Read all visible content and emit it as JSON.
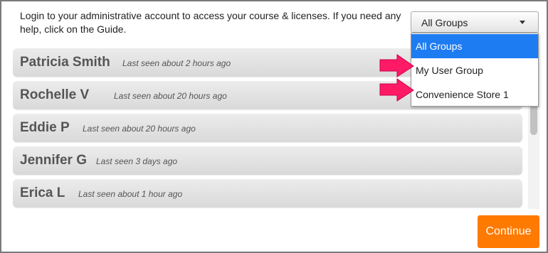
{
  "intro_text": "Login to your administrative account to access your course & licenses. If you need any help, click on the Guide.",
  "users": [
    {
      "name": "Patricia Smith",
      "last_seen": "Last seen about 2 hours ago"
    },
    {
      "name": "Rochelle V",
      "last_seen": "Last seen about 20 hours ago"
    },
    {
      "name": "Eddie P",
      "last_seen": "Last seen about 20 hours ago"
    },
    {
      "name": "Jennifer G",
      "last_seen": "Last seen 3 days ago"
    },
    {
      "name": "Erica L",
      "last_seen": "Last seen about 1 hour ago"
    }
  ],
  "group_select": {
    "selected": "All Groups",
    "options": [
      "All Groups",
      "My User Group",
      "Convenience Store 1"
    ]
  },
  "continue_label": "Continue",
  "colors": {
    "accent": "#ff7a00",
    "highlight": "#1e7cf2",
    "annotation_arrow": "#ff1a66"
  },
  "annotations": {
    "arrows_point_to": [
      "My User Group",
      "Convenience Store 1"
    ]
  }
}
